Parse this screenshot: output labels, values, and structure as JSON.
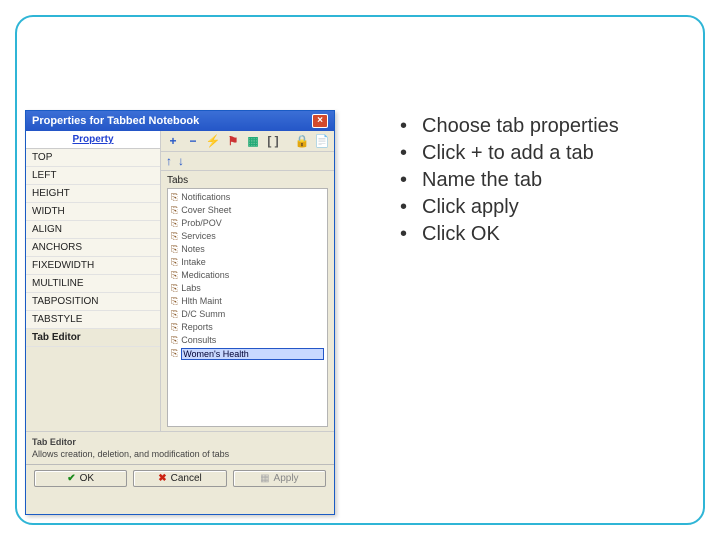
{
  "dialog": {
    "title": "Properties for Tabbed Notebook",
    "property_header": "Property",
    "properties": [
      "TOP",
      "LEFT",
      "HEIGHT",
      "WIDTH",
      "ALIGN",
      "ANCHORS",
      "FIXEDWIDTH",
      "MULTILINE",
      "TABPOSITION",
      "TABSTYLE"
    ],
    "tab_editor_row": "Tab Editor",
    "tabs_label": "Tabs",
    "tabs": [
      "Notifications",
      "Cover Sheet",
      "Prob/POV",
      "Services",
      "Notes",
      "Intake",
      "Medications",
      "Labs",
      "Hlth Maint",
      "D/C Summ",
      "Reports",
      "Consults"
    ],
    "editing_tab_value": "Women's Health",
    "footer_title": "Tab Editor",
    "footer_desc": "Allows creation, deletion, and modification of tabs",
    "buttons": {
      "ok": "OK",
      "cancel": "Cancel",
      "apply": "Apply"
    },
    "toolbar_plus": "+",
    "toolbar_minus": "−"
  },
  "instructions": [
    "Choose tab properties",
    "Click + to add a tab",
    "Name the tab",
    "Click apply",
    "Click OK"
  ]
}
